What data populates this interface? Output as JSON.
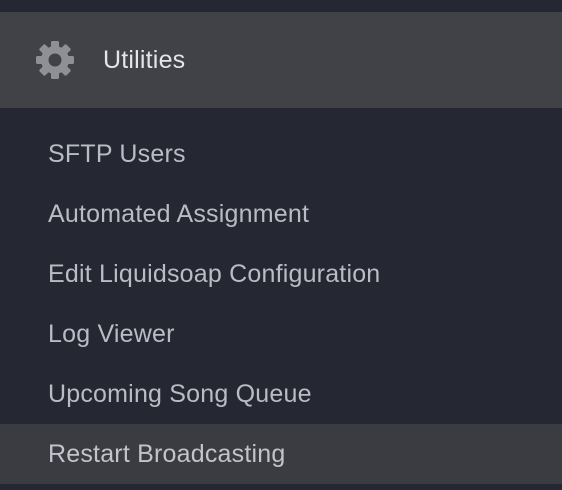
{
  "section": {
    "title": "Utilities",
    "icon": "gear-icon"
  },
  "items": [
    {
      "label": "SFTP Users"
    },
    {
      "label": "Automated Assignment"
    },
    {
      "label": "Edit Liquidsoap Configuration"
    },
    {
      "label": "Log Viewer"
    },
    {
      "label": "Upcoming Song Queue"
    },
    {
      "label": "Restart Broadcasting"
    }
  ],
  "colors": {
    "background": "#252833",
    "header_background": "#404247",
    "active_background": "#3a3c41",
    "text": "#b9bcc3"
  }
}
